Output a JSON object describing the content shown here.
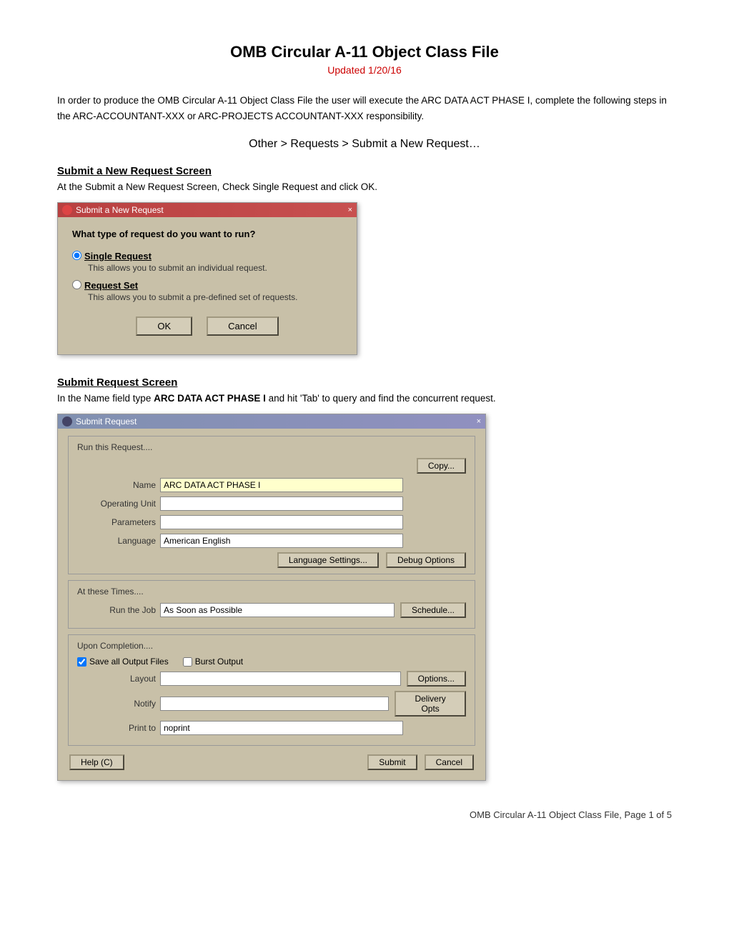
{
  "page": {
    "title": "OMB Circular A-11 Object Class File",
    "subtitle": "Updated 1/20/16",
    "intro": "In order to produce the OMB Circular A-11 Object Class File the user will execute the ARC DATA ACT PHASE I, complete the following steps in the ARC-ACCOUNTANT-XXX or ARC-PROJECTS ACCOUNTANT-XXX responsibility.",
    "nav_path": "Other > Requests > Submit a New Request…",
    "footer": "OMB Circular A-11 Object Class File, Page 1 of 5"
  },
  "section1": {
    "heading": "Submit a New Request Screen",
    "desc": "At the Submit a New Request Screen, Check Single Request and click OK.",
    "dialog": {
      "title": "Submit a New Request",
      "question": "What type of request do you want to run?",
      "option1_label": "Single Request",
      "option1_desc": "This allows you to submit an individual request.",
      "option2_label": "Request Set",
      "option2_desc": "This allows you to submit a pre-defined set of requests.",
      "btn_ok": "OK",
      "btn_cancel": "Cancel"
    }
  },
  "section2": {
    "heading": "Submit Request Screen",
    "desc_prefix": "In the Name field type ",
    "desc_bold": "ARC DATA ACT PHASE I",
    "desc_suffix": " and hit 'Tab' to query and find the concurrent request.",
    "dialog": {
      "title": "Submit Request",
      "close_x": "×",
      "run_section": "Run this Request....",
      "copy_btn": "Copy...",
      "name_label": "Name",
      "name_value": "ARC DATA ACT PHASE I",
      "operating_unit_label": "Operating Unit",
      "operating_unit_value": "",
      "parameters_label": "Parameters",
      "parameters_value": "",
      "language_label": "Language",
      "language_value": "American English",
      "lang_settings_btn": "Language Settings...",
      "debug_options_btn": "Debug Options",
      "at_these_times": "At these Times....",
      "run_job_label": "Run the Job",
      "run_job_value": "As Soon as Possible",
      "schedule_btn": "Schedule...",
      "upon_completion": "Upon Completion....",
      "save_output_label": "Save all Output Files",
      "burst_output_label": "Burst Output",
      "layout_label": "Layout",
      "layout_value": "",
      "notify_label": "Notify",
      "notify_value": "",
      "print_to_label": "Print to",
      "print_to_value": "noprint",
      "options_btn": "Options...",
      "delivery_opts_btn": "Delivery Opts",
      "help_btn": "Help (C)",
      "submit_btn": "Submit",
      "cancel_btn": "Cancel"
    }
  }
}
